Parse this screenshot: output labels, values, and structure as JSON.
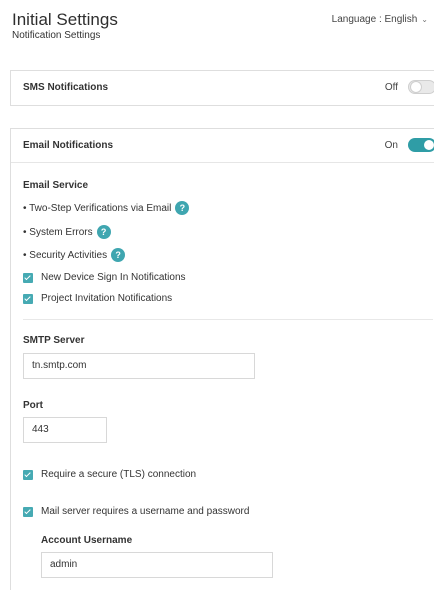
{
  "header": {
    "title": "Initial Settings",
    "subtitle": "Notification Settings",
    "language_label": "Language : English"
  },
  "sms": {
    "title": "SMS Notifications",
    "state_label": "Off",
    "enabled": false
  },
  "email": {
    "title": "Email Notifications",
    "state_label": "On",
    "enabled": true,
    "service_label": "Email Service",
    "bullets": [
      "• Two-Step Verifications via Email",
      "• System Errors",
      "• Security Activities"
    ],
    "checkboxes": [
      "New Device Sign In Notifications",
      "Project Invitation Notifications"
    ],
    "smtp_label": "SMTP Server",
    "smtp_value": "tn.smtp.com",
    "port_label": "Port",
    "port_value": "443",
    "tls_label": "Require a secure (TLS) connection",
    "auth_label": "Mail server requires a username and password",
    "username_label": "Account Username",
    "username_value": "admin"
  },
  "colors": {
    "accent": "#2f9da6",
    "help_icon": "#3fa6b0"
  },
  "icons": {
    "help": "question-mark-icon",
    "language_dropdown": "chevron-down-icon",
    "check": "checkmark-icon"
  }
}
